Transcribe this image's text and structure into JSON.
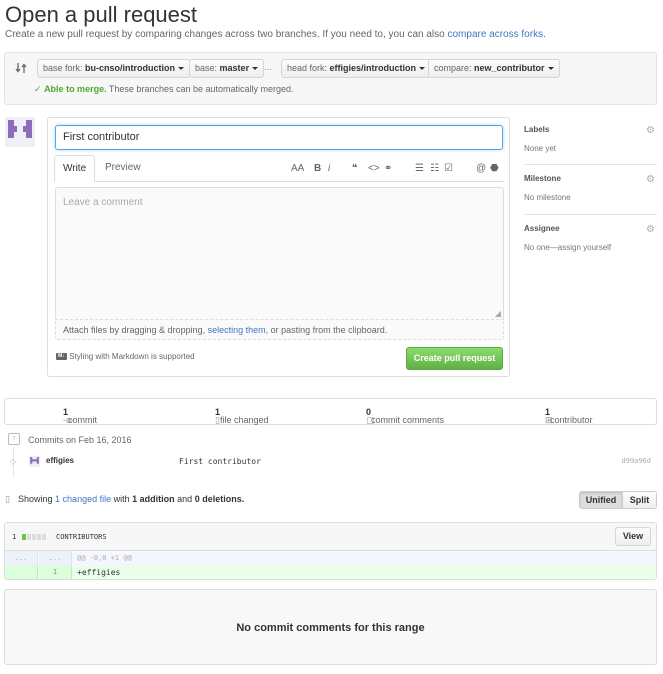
{
  "page": {
    "title": "Open a pull request",
    "subtitle_prefix": "Create a new pull request by comparing changes across two branches. If you need to, you can also",
    "subtitle_link": "compare across forks",
    "subtitle_suffix": "."
  },
  "range": {
    "base_fork_label": "base fork:",
    "base_fork_value": "bu-cnso/introduction",
    "base_label": "base:",
    "base_value": "master",
    "dots": "...",
    "head_fork_label": "head fork:",
    "head_fork_value": "effigies/introduction",
    "compare_label": "compare:",
    "compare_value": "new_contributor",
    "merge_ok": "Able to merge.",
    "merge_text": "These branches can be automatically merged."
  },
  "form": {
    "title_value": "First contributor",
    "tab_write": "Write",
    "tab_preview": "Preview",
    "comment_placeholder": "Leave a comment",
    "attach_prefix": "Attach files by dragging & dropping,",
    "attach_link": "selecting them",
    "attach_suffix": ", or pasting from the clipboard.",
    "markdown_note": "Styling with Markdown is supported",
    "create_button": "Create pull request",
    "toolbar": {
      "text_size": "AA",
      "bold": "B",
      "italic": "i",
      "quote": "❝",
      "code": "<>",
      "link": "⚭",
      "ul": "☰",
      "ol": "☷",
      "task": "☑",
      "mention": "@",
      "bookmark": "⬣"
    }
  },
  "sidebar": {
    "labels_title": "Labels",
    "labels_value": "None yet",
    "milestone_title": "Milestone",
    "milestone_value": "No milestone",
    "assignee_title": "Assignee",
    "assignee_value": "No one—assign yourself"
  },
  "stats": {
    "commits_num": "1",
    "commits_label": "commit",
    "files_num": "1",
    "files_label": "file changed",
    "comments_num": "0",
    "comments_label": "commit comments",
    "contributors_num": "1",
    "contributors_label": "contributor"
  },
  "commits": {
    "header": "Commits on Feb 16, 2016",
    "author": "effigies",
    "message": "First contributor",
    "sha": "d99a96d"
  },
  "diff": {
    "showing": "Showing",
    "changed_link": "1 changed file",
    "with": "with",
    "additions": "1 addition",
    "and": "and",
    "deletions": "0 deletions.",
    "unified": "Unified",
    "split": "Split",
    "file_count": "1",
    "file_name": "CONTRIBUTORS",
    "view_button": "View",
    "hunk_left": "...",
    "hunk_right": "...",
    "hunk_header": "@@ -0,0 +1 @@",
    "line_num": "1",
    "line_text": "+effigies"
  },
  "no_comments": "No commit comments for this range",
  "colors": {
    "link": "#4078c0",
    "merge_ok": "#55a532",
    "create_button": "#60b044",
    "avatar": "#8e6dbd"
  }
}
